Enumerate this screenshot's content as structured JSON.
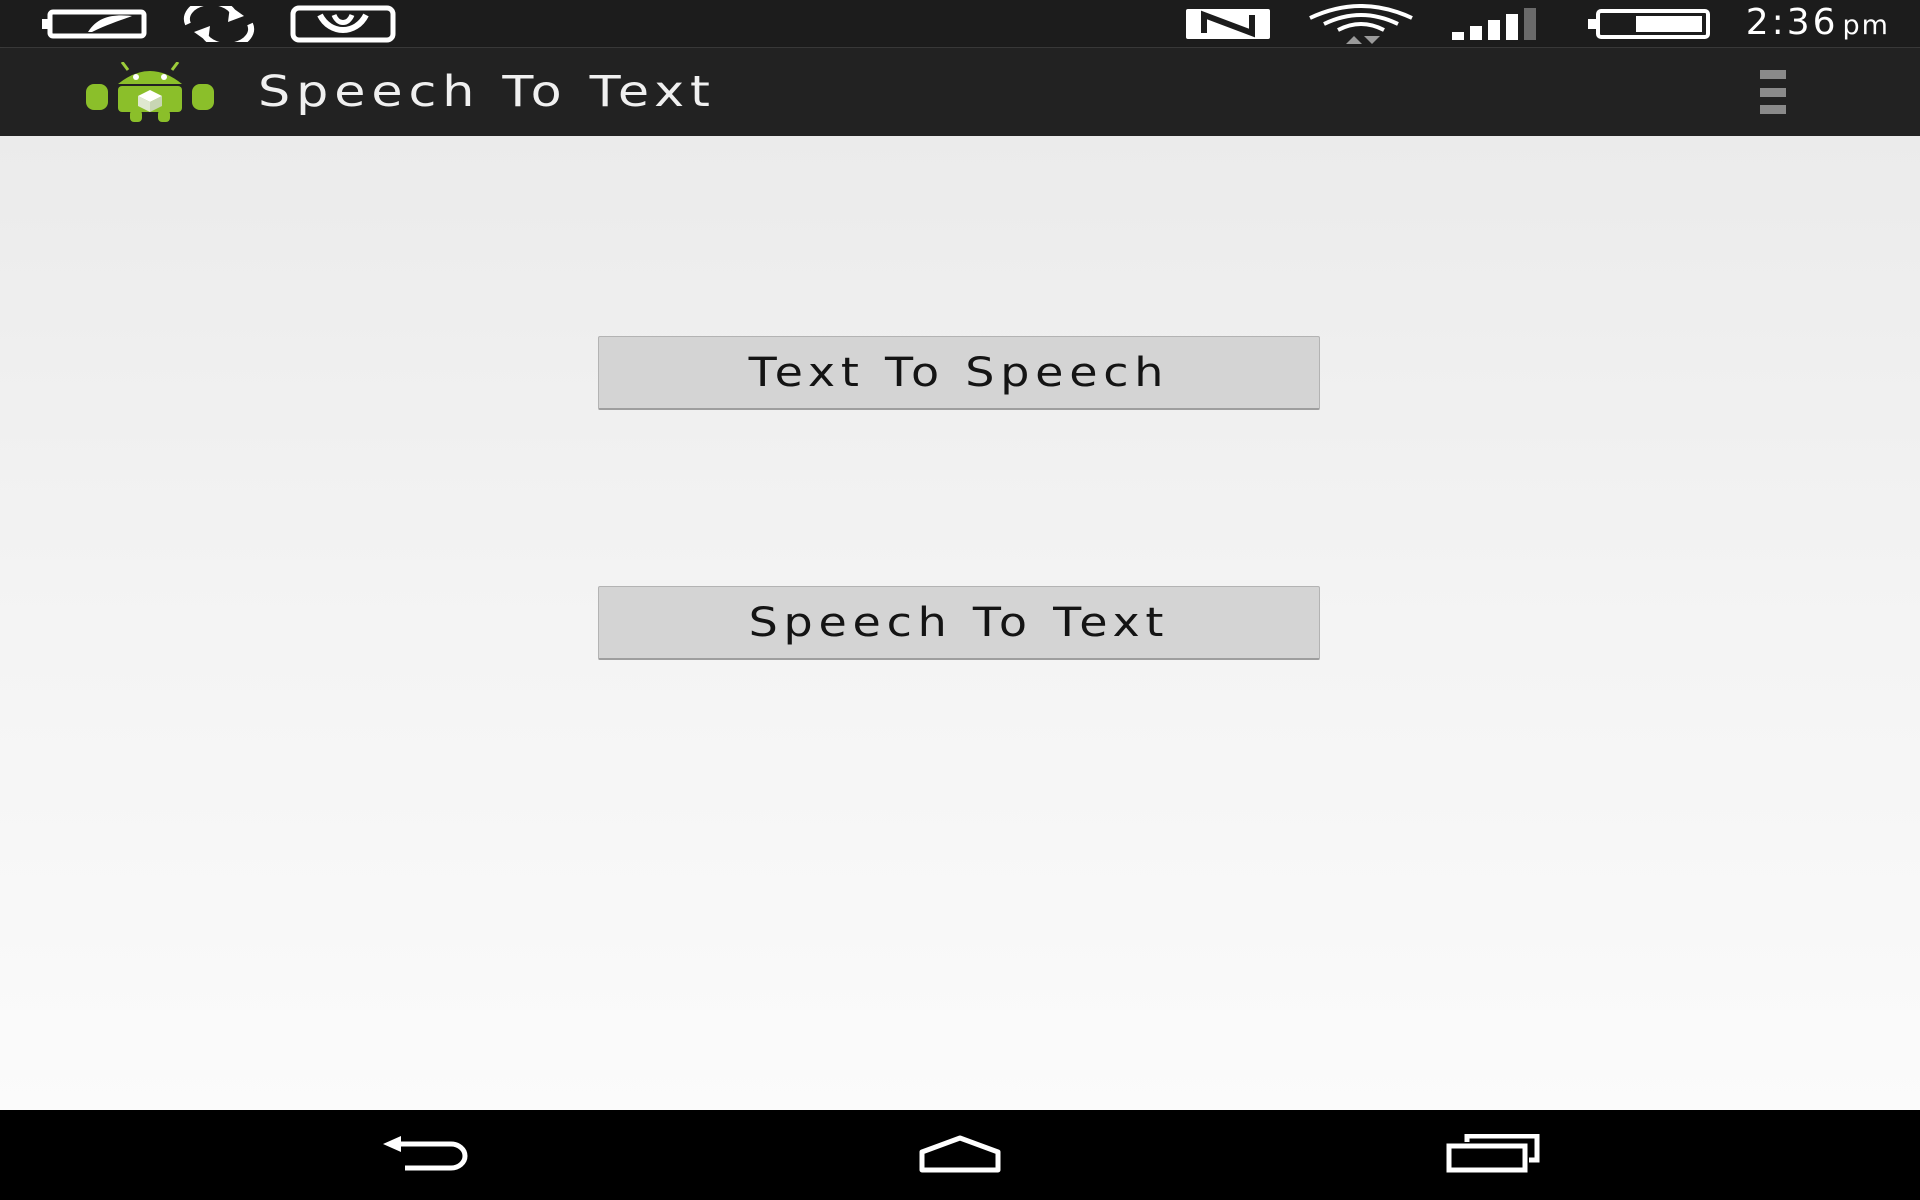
{
  "status_bar": {
    "icons_left": [
      "battery-saver-icon",
      "sync-icon",
      "saavn-icon"
    ],
    "icons_right": [
      "nfc-icon",
      "wifi-icon",
      "signal-icon",
      "battery-icon"
    ],
    "time": "2:36",
    "ampm": "pm"
  },
  "action_bar": {
    "icon": "android-icon",
    "title": "Speech To Text",
    "overflow_icon": "overflow-menu-icon"
  },
  "content": {
    "buttons": [
      {
        "label": "Text To Speech"
      },
      {
        "label": "Speech To Text"
      }
    ]
  },
  "nav_bar": {
    "icons": [
      "back-icon",
      "home-icon",
      "recents-icon"
    ]
  },
  "colors": {
    "status_bar_bg": "#1c1c1c",
    "action_bar_bg": "#222222",
    "content_bg": "#f5f5f5",
    "button_bg": "#d4d4d4",
    "nav_bar_bg": "#000000",
    "android_green": "#8bbf2a"
  }
}
